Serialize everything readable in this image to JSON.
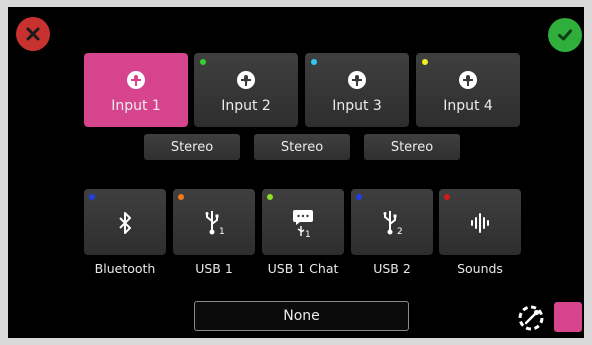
{
  "colors": {
    "accent": "#d6448e",
    "cancel": "#c7322f",
    "confirm": "#2fae3b",
    "button_bg": "#3a3a3a"
  },
  "header": {
    "cancel_icon": "close-icon",
    "confirm_icon": "check-icon"
  },
  "inputs": [
    {
      "label": "Input 1",
      "selected": true,
      "dot": null
    },
    {
      "label": "Input 2",
      "selected": false,
      "dot": "#33d32c"
    },
    {
      "label": "Input 3",
      "selected": false,
      "dot": "#35c8ef"
    },
    {
      "label": "Input 4",
      "selected": false,
      "dot": "#f0f021"
    }
  ],
  "stereo": [
    "Stereo",
    "Stereo",
    "Stereo"
  ],
  "sources": [
    {
      "label": "Bluetooth",
      "icon": "bluetooth-icon",
      "dot": "#1f3ee3"
    },
    {
      "label": "USB 1",
      "icon": "usb-1-icon",
      "dot": "#ef7d12"
    },
    {
      "label": "USB 1 Chat",
      "icon": "usb-1-chat-icon",
      "dot": "#8be024"
    },
    {
      "label": "USB 2",
      "icon": "usb-2-icon",
      "dot": "#1f3ee3"
    },
    {
      "label": "Sounds",
      "icon": "waveform-icon",
      "dot": "#d11b1b"
    }
  ],
  "footer": {
    "selection": "None",
    "gear_icon": "gear-eyedropper-icon",
    "swatch_color": "#d6448e"
  }
}
